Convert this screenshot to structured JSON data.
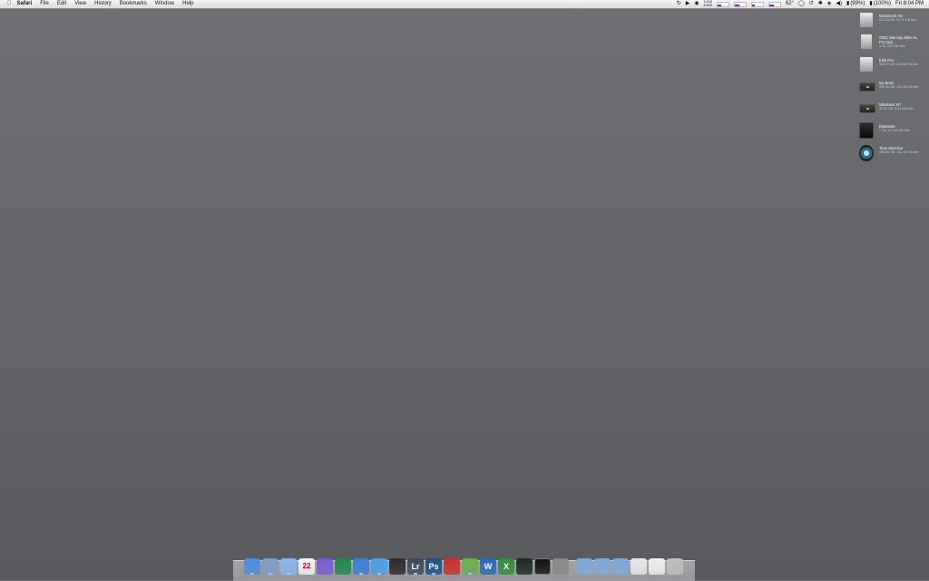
{
  "menubar": {
    "app": "Safari",
    "menus": [
      "File",
      "Edit",
      "View",
      "History",
      "Bookmarks",
      "Window",
      "Help"
    ],
    "status": {
      "net_up": "5.1KB",
      "net_down": "8.9KB",
      "temperature": "62°",
      "battery_1": "(99%)",
      "battery_2": "(100%)",
      "clock": "Fri 8:04 PM"
    },
    "meters": [
      0.35,
      0.4,
      0.3,
      0.45
    ]
  },
  "volumes": [
    {
      "name": "Macintosh HD",
      "info": "115.18 GB, 12.74 GB free",
      "icon": "internal-drive-icon"
    },
    {
      "name": "OWC Mercury Elite-AL",
      "name2": "Pro Qx2",
      "info": "1 TB, 220 GB free",
      "icon": "external-drive-icon"
    },
    {
      "name": "Elite Pro",
      "info": "300.07 GB, 116.55 GB free",
      "icon": "internal-drive-icon"
    },
    {
      "name": "My Book",
      "info": "250.06 GB, 110.18 GB free",
      "icon": "firewire-drive-icon"
    },
    {
      "name": "Windows XP",
      "info": "40.01 GB, 6.84 GB free",
      "icon": "firewire-drive-icon"
    },
    {
      "name": "Elements",
      "info": "1 TB, 327.51 GB free",
      "icon": "black-drive-icon"
    },
    {
      "name": "Time Machine",
      "info": "999.86 GB, 761.18 GB free",
      "icon": "time-machine-icon"
    }
  ],
  "dock": [
    {
      "name": "finder-icon",
      "color": "#4a8fe0",
      "label": ""
    },
    {
      "name": "mail-icon",
      "color": "#7f9bc4",
      "label": ""
    },
    {
      "name": "safari-icon",
      "color": "#8ab4e8",
      "label": ""
    },
    {
      "name": "ical-icon",
      "color": "#f3f3f3",
      "label": "22"
    },
    {
      "name": "pinwheel-icon",
      "color": "#7a5bd0",
      "label": ""
    },
    {
      "name": "play-icon",
      "color": "#1e8a4e",
      "label": ""
    },
    {
      "name": "itunes-icon",
      "color": "#3a7fd6",
      "label": ""
    },
    {
      "name": "app-store-icon",
      "color": "#4ba0e6",
      "label": ""
    },
    {
      "name": "camera-icon",
      "color": "#2b2b2b",
      "label": ""
    },
    {
      "name": "lightroom-icon",
      "color": "#3f4a5a",
      "label": "Lr"
    },
    {
      "name": "photoshop-icon",
      "color": "#1e4f82",
      "label": "Ps"
    },
    {
      "name": "red-app-icon",
      "color": "#c9302c",
      "label": ""
    },
    {
      "name": "evernote-icon",
      "color": "#6ab04c",
      "label": ""
    },
    {
      "name": "word-icon",
      "color": "#2a6ab8",
      "label": "W"
    },
    {
      "name": "excel-icon",
      "color": "#2f8f3c",
      "label": "X"
    },
    {
      "name": "activity-monitor-icon",
      "color": "#1c2b22",
      "label": ""
    },
    {
      "name": "terminal-icon",
      "color": "#111111",
      "label": ""
    },
    {
      "name": "system-preferences-icon",
      "color": "#8a8a8a",
      "label": ""
    },
    {
      "name": "applications-folder-icon",
      "color": "#7fa8d8",
      "label": ""
    },
    {
      "name": "documents-folder-icon",
      "color": "#7fa8d8",
      "label": ""
    },
    {
      "name": "downloads-folder-icon",
      "color": "#7fa8d8",
      "label": ""
    },
    {
      "name": "document-stack-icon",
      "color": "#e8e8e8",
      "label": ""
    },
    {
      "name": "image-stack-icon",
      "color": "#f0f0f0",
      "label": ""
    },
    {
      "name": "trash-icon",
      "color": "#bfbfbf",
      "label": ""
    }
  ]
}
